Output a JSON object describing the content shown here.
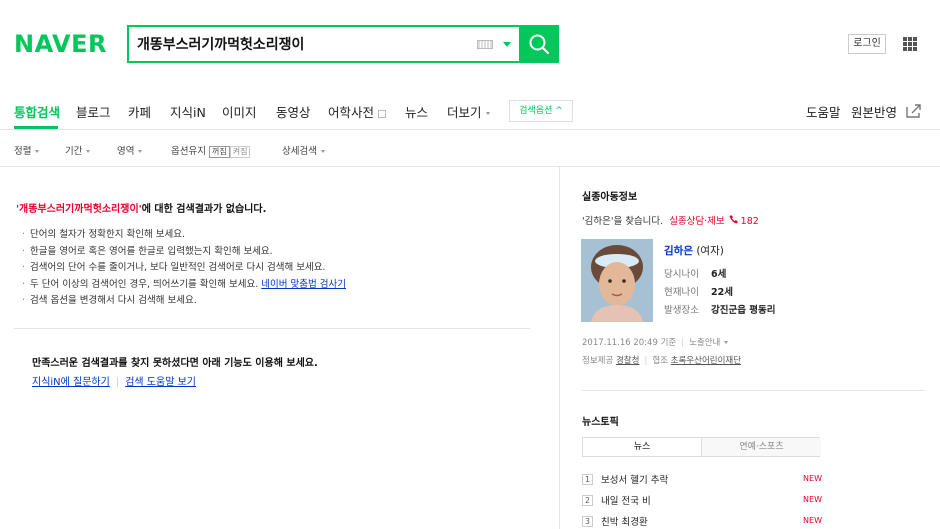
{
  "header": {
    "logo": "NAVER",
    "search_value": "개똥부스러기까먹헛소리쟁이",
    "login_label": "로그인",
    "brand_color": "#03c75a"
  },
  "nav": {
    "items": [
      "통합검색",
      "블로그",
      "카페",
      "지식iN",
      "이미지",
      "동영상",
      "어학사전",
      "뉴스",
      "더보기"
    ],
    "option_label": "검색옵션 ^",
    "help": "도움말",
    "original": "원본반영"
  },
  "filter": {
    "sort": "정렬",
    "period": "기간",
    "area": "영역",
    "keep_option": "옵션유지",
    "toggle_off": "꺼짐",
    "toggle_on": "켜짐",
    "detail": "상세검색"
  },
  "main": {
    "query_quoted": "'개똥부스러기까먹헛소리쟁이'",
    "no_result_suffix": "에 대한 검색결과가 없습니다.",
    "tips": [
      "단어의 철자가 정확한지 확인해 보세요.",
      "한글을 영어로 혹은 영어를 한글로 입력했는지 확인해 보세요.",
      "검색어의 단어 수를 줄이거나, 보다 일반적인 검색어로 다시 검색해 보세요.",
      "두 단어 이상의 검색어인 경우, 띄어쓰기를 확인해 보세요."
    ],
    "spell_link": "네이버 맞춤법 검사기",
    "tip_last": "검색 옵션을 변경해서 다시 검색해 보세요.",
    "suggest_title": "만족스러운 검색결과를 찾지 못하셨다면 아래 기능도 이용해 보세요.",
    "link_kin": "지식iN에 질문하기",
    "link_help": "검색 도움말 보기"
  },
  "missing": {
    "title": "실종아동정보",
    "find_text": "'김하은'을 찾습니다.",
    "report_text": "실종상담·제보",
    "phone": "182",
    "name": "김하은",
    "gender": "(여자)",
    "rows": [
      {
        "k": "당시나이",
        "v": "6세"
      },
      {
        "k": "현재나이",
        "v": "22세"
      },
      {
        "k": "발생장소",
        "v": "강진군읍 평동리"
      }
    ],
    "date": "2017.11.16 20:49 기준",
    "exposure": "노출안내",
    "provider_label": "정보제공",
    "provider": "경찰청",
    "coop_label": "협조",
    "coop": "초록우산어린이재단"
  },
  "news": {
    "title": "뉴스토픽",
    "tab_news": "뉴스",
    "tab_ent": "연예·스포츠",
    "items": [
      {
        "n": "1",
        "t": "보성서 헬기 추락",
        "badge": "NEW"
      },
      {
        "n": "2",
        "t": "내일 전국 비",
        "badge": "NEW"
      },
      {
        "n": "3",
        "t": "친박 최경환",
        "badge": "NEW"
      }
    ]
  }
}
